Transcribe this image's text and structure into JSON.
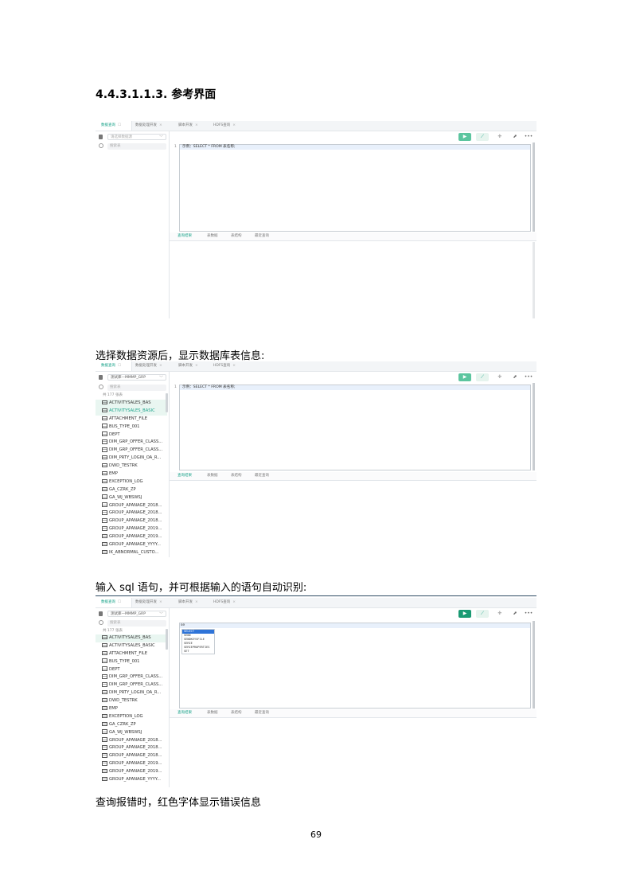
{
  "doc": {
    "heading": "4.4.3.1.1.3. 参考界面",
    "para1": "选择数据资源后，显示数据库表信息:",
    "para2": "输入 sql 语句，并可根据输入的语句自动识别:",
    "para3": "查询报错时，红色字体显示错误信息",
    "page_number": "69"
  },
  "app": {
    "tabs": [
      "数据查询",
      "数据处理开发",
      "脚本开发",
      "HDFS查询"
    ],
    "tab_close": "×",
    "db_placeholder": "请选择数据源",
    "db_selected": "测试库—MMMP_GRP",
    "search_placeholder": "搜索表",
    "table_count": "共 177 张表",
    "editor_placeholder": "示例：SELECT * FROM 表名称;",
    "typed_text": "se",
    "line_number": "1",
    "result_tabs": [
      "查询结果",
      "表数据",
      "表结构",
      "最近查询"
    ],
    "icons": {
      "run": "play-icon",
      "format": "magic-wand-icon",
      "fullscreen": "move-icon",
      "export": "export-icon",
      "more": "more-icon"
    },
    "accent_color": "#1aa38a",
    "autocomplete": [
      "SELECT",
      "SEND",
      "SENDKEYSFILE",
      "SERIE",
      "SERIEPROPERTIES",
      "SET"
    ],
    "tables_full": [
      "ACTIVITYSALES_BAS",
      "ACTIVITYSALES_BASIC",
      "ATTACHMENT_FILE",
      "BUS_TYPE_001",
      "DEPT",
      "DIM_GRP_OFFER_CLASS...",
      "DIM_GRP_OFFER_CLASS...",
      "DIM_PRTY_LOGIN_OA_R...",
      "DWD_TESTRK",
      "EMP",
      "EXCEPTION_LOG",
      "GA_CZRK_ZP",
      "GA_WJ_WBSWSJ",
      "GROUP_APANAGE_2018...",
      "GROUP_APANAGE_2018...",
      "GROUP_APANAGE_2018...",
      "GROUP_APANAGE_2019...",
      "GROUP_APANAGE_2019...",
      "GROUP_APANAGE_YYYY...",
      "IK_ABNORMAL_CUSTO..."
    ],
    "tables_short": [
      "ACTIVITYSALES_BAS",
      "ACTIVITYSALES_BASIC",
      "ATTACHMENT_FILE",
      "BUS_TYPE_001",
      "DEPT",
      "DIM_GRP_OFFER_CLASS...",
      "DIM_GRP_OFFER_CLASS...",
      "DIM_PRTY_LOGIN_OA_R...",
      "DWD_TESTRK",
      "EMP",
      "EXCEPTION_LOG",
      "GA_CZRK_ZP",
      "GA_WJ_WBSWSJ",
      "GROUP_APANAGE_2018...",
      "GROUP_APANAGE_2018...",
      "GROUP_APANAGE_2018...",
      "GROUP_APANAGE_2019...",
      "GROUP_APANAGE_2019...",
      "GROUP_APANAGE_YYYY..."
    ]
  }
}
